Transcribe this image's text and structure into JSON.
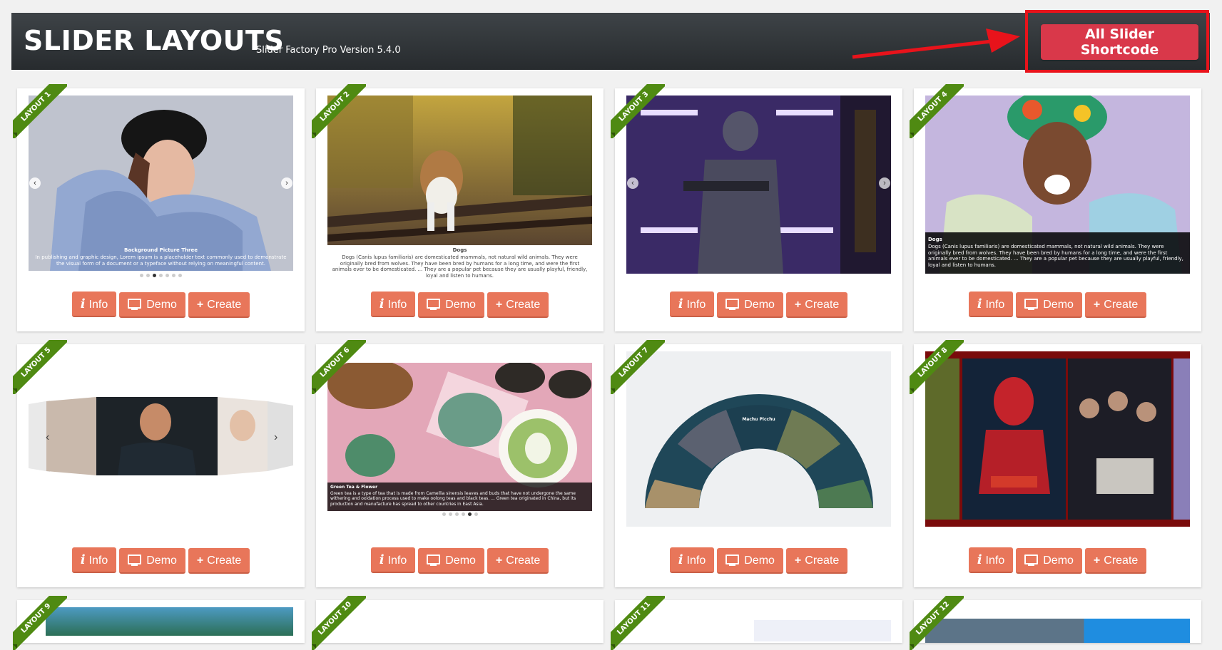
{
  "header": {
    "title": "SLIDER LAYOUTS",
    "version": "Slider Factory Pro Version 5.4.0",
    "shortcode_button": "All Slider Shortcode"
  },
  "buttons": {
    "info": "Info",
    "demo": "Demo",
    "create": "Create"
  },
  "colors": {
    "header_bg": "#2c3033",
    "shortcode_button": "#d9384a",
    "highlight_frame": "#e8131b",
    "action_button": "#e8765a",
    "ribbon": "#4f8a12"
  },
  "icons": {
    "info": "info-icon",
    "demo": "desktop-icon",
    "create": "plus-icon"
  },
  "layouts": [
    {
      "ribbon": "LAYOUT 1",
      "caption_title": "Background Picture Three",
      "caption_text": "In publishing and graphic design, Lorem ipsum is a placeholder text commonly used to demonstrate the visual form of a document or a typeface without relying on meaningful content."
    },
    {
      "ribbon": "LAYOUT 2",
      "caption_title": "Dogs",
      "caption_text": "Dogs (Canis lupus familiaris) are domesticated mammals, not natural wild animals. They were originally bred from wolves. They have been bred by humans for a long time, and were the first animals ever to be domesticated. ... They are a popular pet because they are usually playful, friendly, loyal and listen to humans."
    },
    {
      "ribbon": "LAYOUT 3"
    },
    {
      "ribbon": "LAYOUT 4",
      "caption_title": "Dogs",
      "caption_text": "Dogs (Canis lupus familiaris) are domesticated mammals, not natural wild animals. They were originally bred from wolves. They have been bred by humans for a long time, and were the first animals ever to be domesticated. ... They are a popular pet because they are usually playful, friendly, loyal and listen to humans."
    },
    {
      "ribbon": "LAYOUT 5"
    },
    {
      "ribbon": "LAYOUT 6",
      "caption_title": "Green Tea & Flower",
      "caption_text": "Green tea is a type of tea that is made from Camellia sinensis leaves and buds that have not undergone the same withering and oxidation process used to make oolong teas and black teas. ... Green tea originated in China, but its production and manufacture has spread to other countries in East Asia."
    },
    {
      "ribbon": "LAYOUT 7",
      "caption_title": "Machu Picchu"
    },
    {
      "ribbon": "LAYOUT 8"
    },
    {
      "ribbon": "LAYOUT 9"
    },
    {
      "ribbon": "LAYOUT 10"
    },
    {
      "ribbon": "LAYOUT 11"
    },
    {
      "ribbon": "LAYOUT 12"
    }
  ]
}
